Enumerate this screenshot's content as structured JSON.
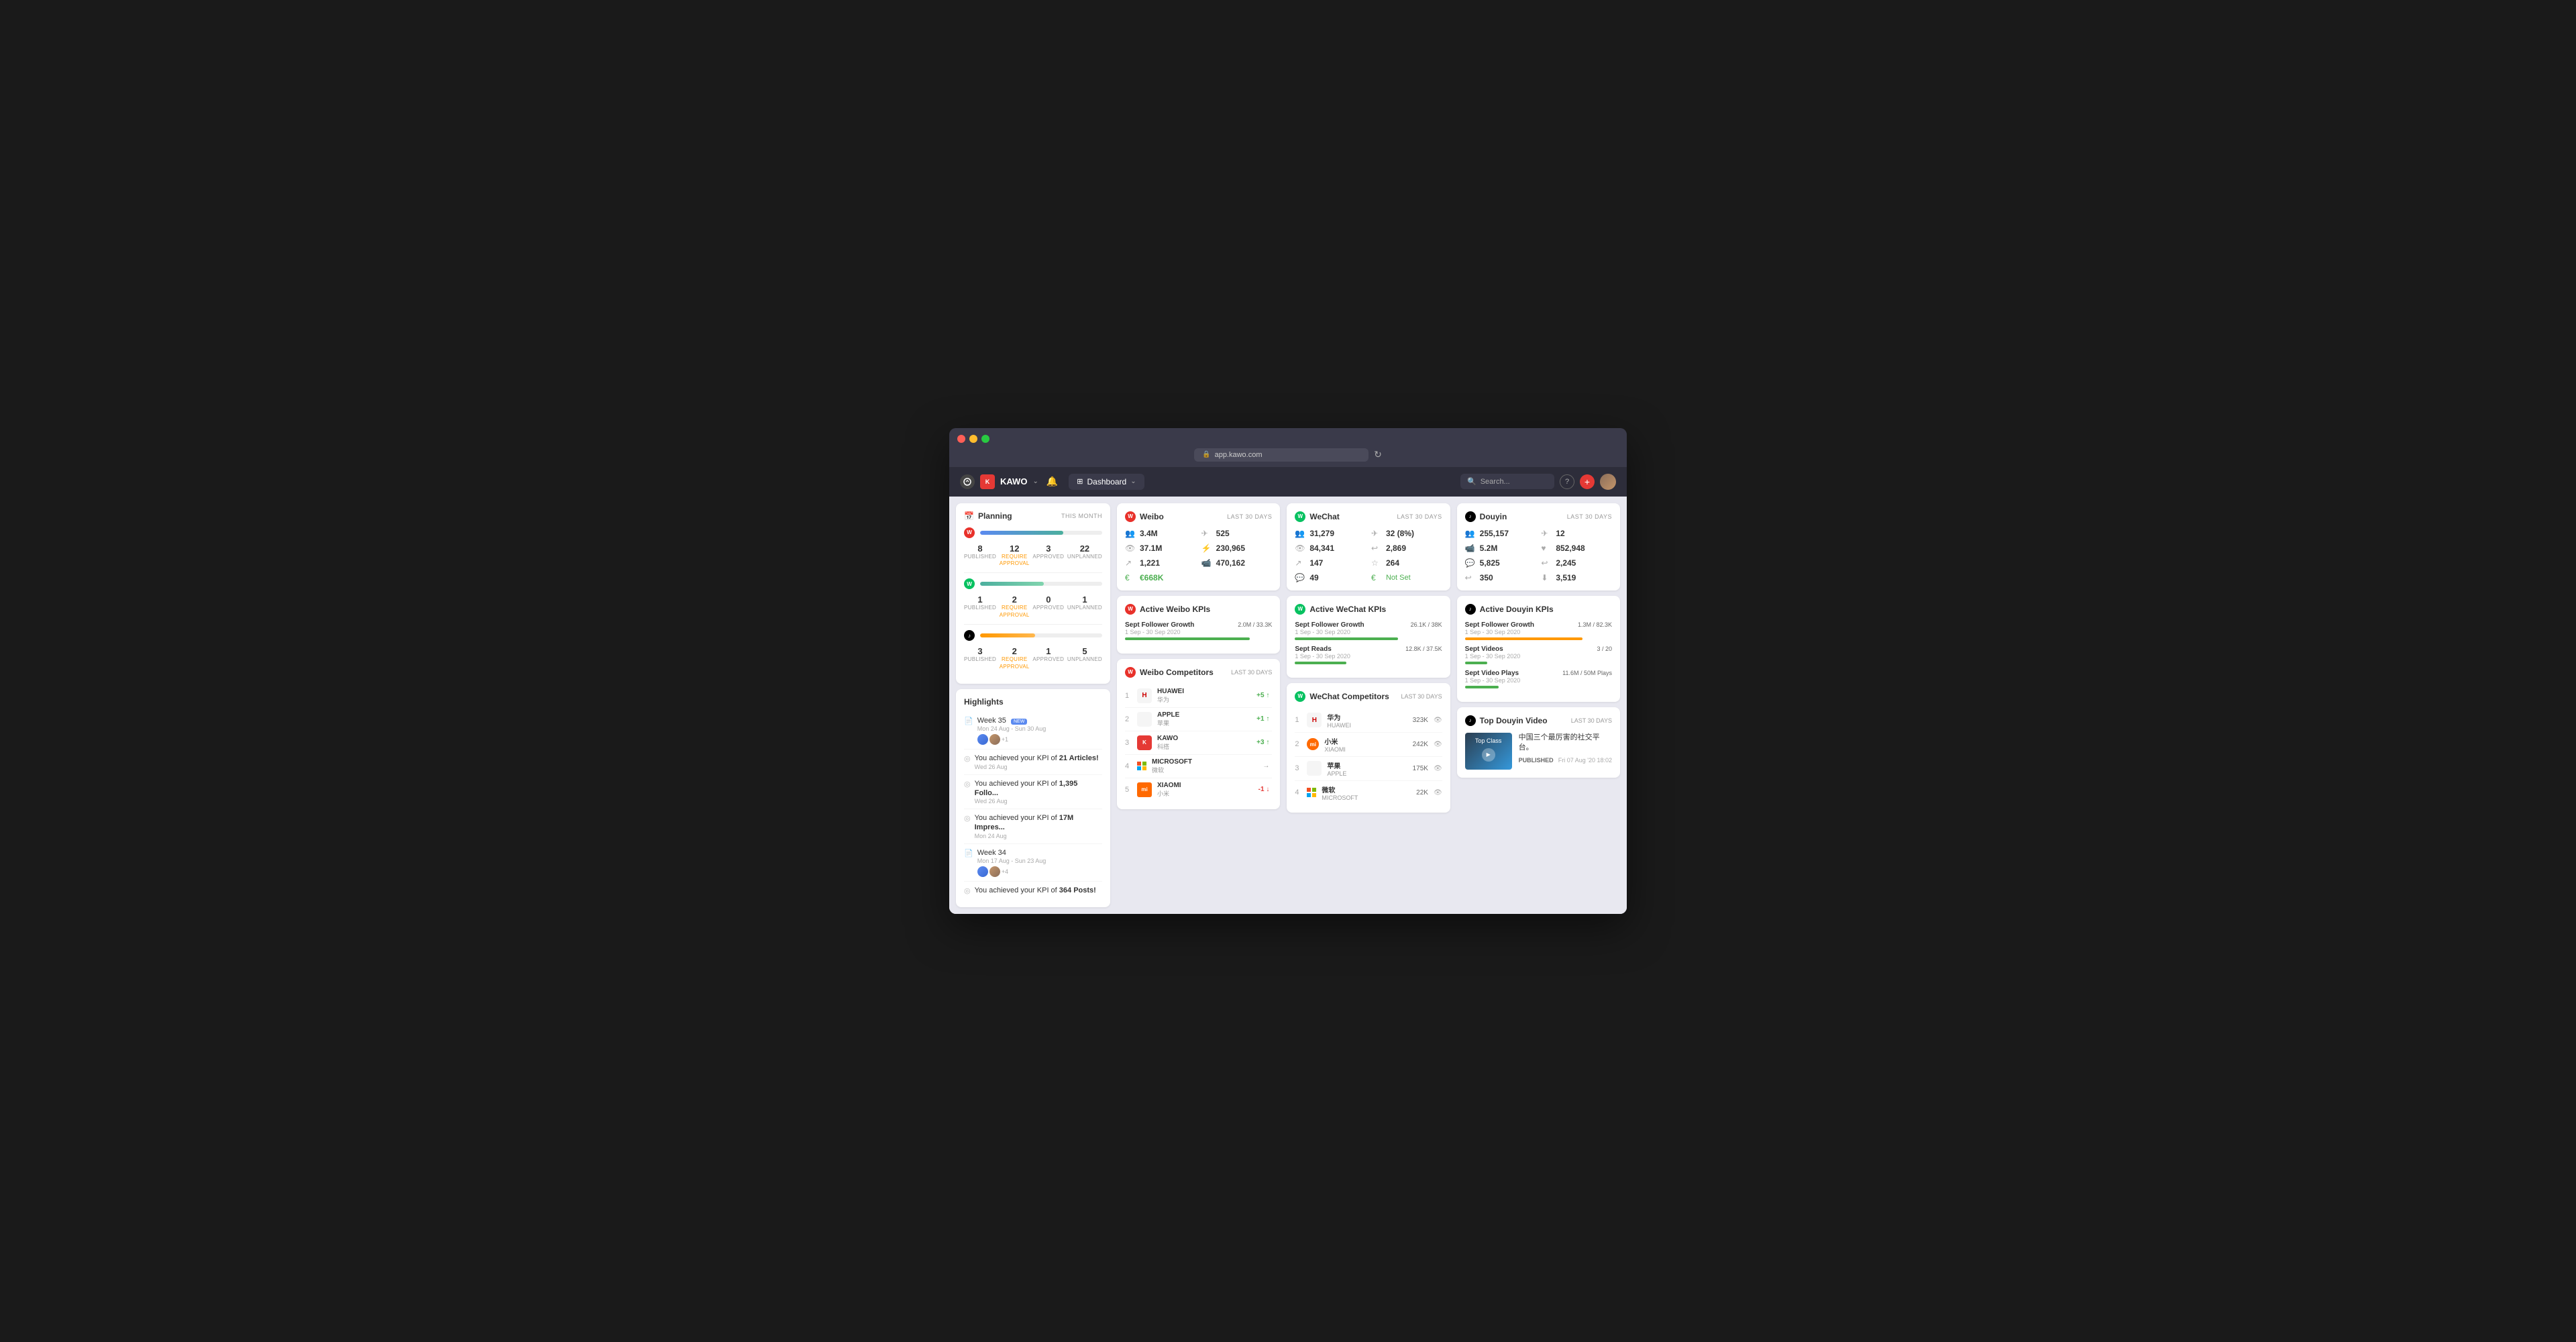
{
  "browser": {
    "url": "app.kawo.com",
    "reload_icon": "↻"
  },
  "nav": {
    "app_name": "KAWO",
    "dashboard_label": "Dashboard",
    "search_placeholder": "Search...",
    "help_label": "?",
    "plus_label": "+",
    "chevron": "⌄",
    "bell": "🔔"
  },
  "planning": {
    "title": "Planning",
    "period": "THIS MONTH",
    "platforms": [
      {
        "name": "weibo",
        "progress": 68,
        "published": 8,
        "require_approval": 12,
        "approved": 3,
        "unplanned": 22
      },
      {
        "name": "wechat",
        "progress": 52,
        "published": 1,
        "require_approval": 2,
        "approved": 0,
        "unplanned": 1
      },
      {
        "name": "douyin",
        "progress": 45,
        "published": 3,
        "require_approval": 2,
        "approved": 1,
        "unplanned": 5
      }
    ],
    "labels": {
      "published": "PUBLISHED",
      "require_approval": "REQUIRE\nAPPROVAL",
      "approved": "APPROVED",
      "unplanned": "UNPLANNED"
    }
  },
  "highlights": {
    "title": "Highlights",
    "items": [
      {
        "type": "document",
        "title": "Week 35",
        "badge": "NEW",
        "date": "Mon 24 Aug - Sun 30 Aug",
        "avatars": true,
        "extra": "+1"
      },
      {
        "type": "trophy",
        "title": "You achieved your KPI of 21 Articles!",
        "date": "Wed 26 Aug"
      },
      {
        "type": "trophy",
        "title": "You achieved your KPI of 1,395 Follo...",
        "date": "Wed 26 Aug"
      },
      {
        "type": "trophy",
        "title": "You achieved your KPI of 17M Impres...",
        "date": "Mon 24 Aug"
      },
      {
        "type": "document",
        "title": "Week 34",
        "date": "Mon 17 Aug - Sun 23 Aug",
        "avatars": true,
        "extra": "+4"
      },
      {
        "type": "trophy",
        "title": "You achieved your KPI of 364 Posts!",
        "date": "..."
      }
    ]
  },
  "weibo": {
    "title": "Weibo",
    "period": "LAST 30 DAYS",
    "followers": "3.4M",
    "messages_sent": "525",
    "views": "37.1M",
    "interactions": "230,965",
    "shares": "1,221",
    "video_views": "470,162",
    "cost": "€668K"
  },
  "wechat": {
    "title": "WeChat",
    "period": "LAST 30 DAYS",
    "followers": "31,279",
    "messages_sent": "32 (8%)",
    "views": "84,341",
    "shares": "2,869",
    "clicks": "147",
    "saves": "264",
    "comments": "49",
    "cost": "Not Set"
  },
  "douyin": {
    "title": "Douyin",
    "period": "LAST 30 DAYS",
    "followers": "255,157",
    "messages": "12",
    "video_plays": "5.2M",
    "likes": "852,948",
    "comments": "5,825",
    "shares": "2,245",
    "reposts": "350",
    "downloads": "3,519"
  },
  "weibo_kpi": {
    "title": "Active Weibo KPIs",
    "items": [
      {
        "label": "Sept Follower Growth",
        "date": "1 Sep - 30 Sep 2020",
        "value": "2.0M / 33.3K",
        "progress": 85,
        "color": "green"
      }
    ]
  },
  "wechat_kpi": {
    "title": "Active WeChat KPIs",
    "items": [
      {
        "label": "Sept Follower Growth",
        "date": "1 Sep - 30 Sep 2020",
        "value": "26.1K / 38K",
        "progress": 70,
        "color": "green"
      },
      {
        "label": "Sept Reads",
        "date": "1 Sep - 30 Sep 2020",
        "value": "12.8K / 37.5K",
        "progress": 35,
        "color": "green"
      }
    ]
  },
  "douyin_kpi": {
    "title": "Active Douyin KPIs",
    "items": [
      {
        "label": "Sept Follower Growth",
        "date": "1 Sep - 30 Sep 2020",
        "value": "1.3M / 82.3K",
        "progress": 80,
        "color": "orange"
      },
      {
        "label": "Sept Videos",
        "date": "1 Sep - 30 Sep 2020",
        "value": "3 / 20",
        "progress": 15,
        "color": "green"
      },
      {
        "label": "Sept Video Plays",
        "date": "1 Sep - 30 Sep 2020",
        "value": "11.6M / 50M Plays",
        "progress": 23,
        "color": "green"
      }
    ]
  },
  "weibo_competitors": {
    "title": "Weibo Competitors",
    "period": "LAST 30 DAYS",
    "items": [
      {
        "rank": 1,
        "name_en": "HUAWEI",
        "name_cn": "华为",
        "change": "+5",
        "direction": "up"
      },
      {
        "rank": 2,
        "name_en": "APPLE",
        "name_cn": "苹果",
        "change": "+1",
        "direction": "up"
      },
      {
        "rank": 3,
        "name_en": "KAWO",
        "name_cn": "科搭",
        "change": "+3",
        "direction": "up"
      },
      {
        "rank": 4,
        "name_en": "MICROSOFT",
        "name_cn": "微软",
        "change": "→",
        "direction": "neutral"
      },
      {
        "rank": 5,
        "name_en": "XIAOMI",
        "name_cn": "小米",
        "change": "-1",
        "direction": "down"
      }
    ]
  },
  "wechat_competitors": {
    "title": "WeChat Competitors",
    "period": "LAST 30 DAYS",
    "items": [
      {
        "rank": 1,
        "name_en": "华为",
        "name_cn": "HUAWEI",
        "views": "323K"
      },
      {
        "rank": 2,
        "name_en": "小米",
        "name_cn": "XIAOMI",
        "views": "242K"
      },
      {
        "rank": 3,
        "name_en": "苹果",
        "name_cn": "APPLE",
        "views": "175K"
      },
      {
        "rank": 4,
        "name_en": "微软",
        "name_cn": "MICROSOFT",
        "views": "22K"
      }
    ]
  },
  "top_douyin_video": {
    "title": "Top Douyin Video",
    "period": "LAST 30 DAYS",
    "description": "中国三个最厉害的社交平台。",
    "status": "PUBLISHED",
    "date": "Fri 07 Aug '20 18:02"
  }
}
